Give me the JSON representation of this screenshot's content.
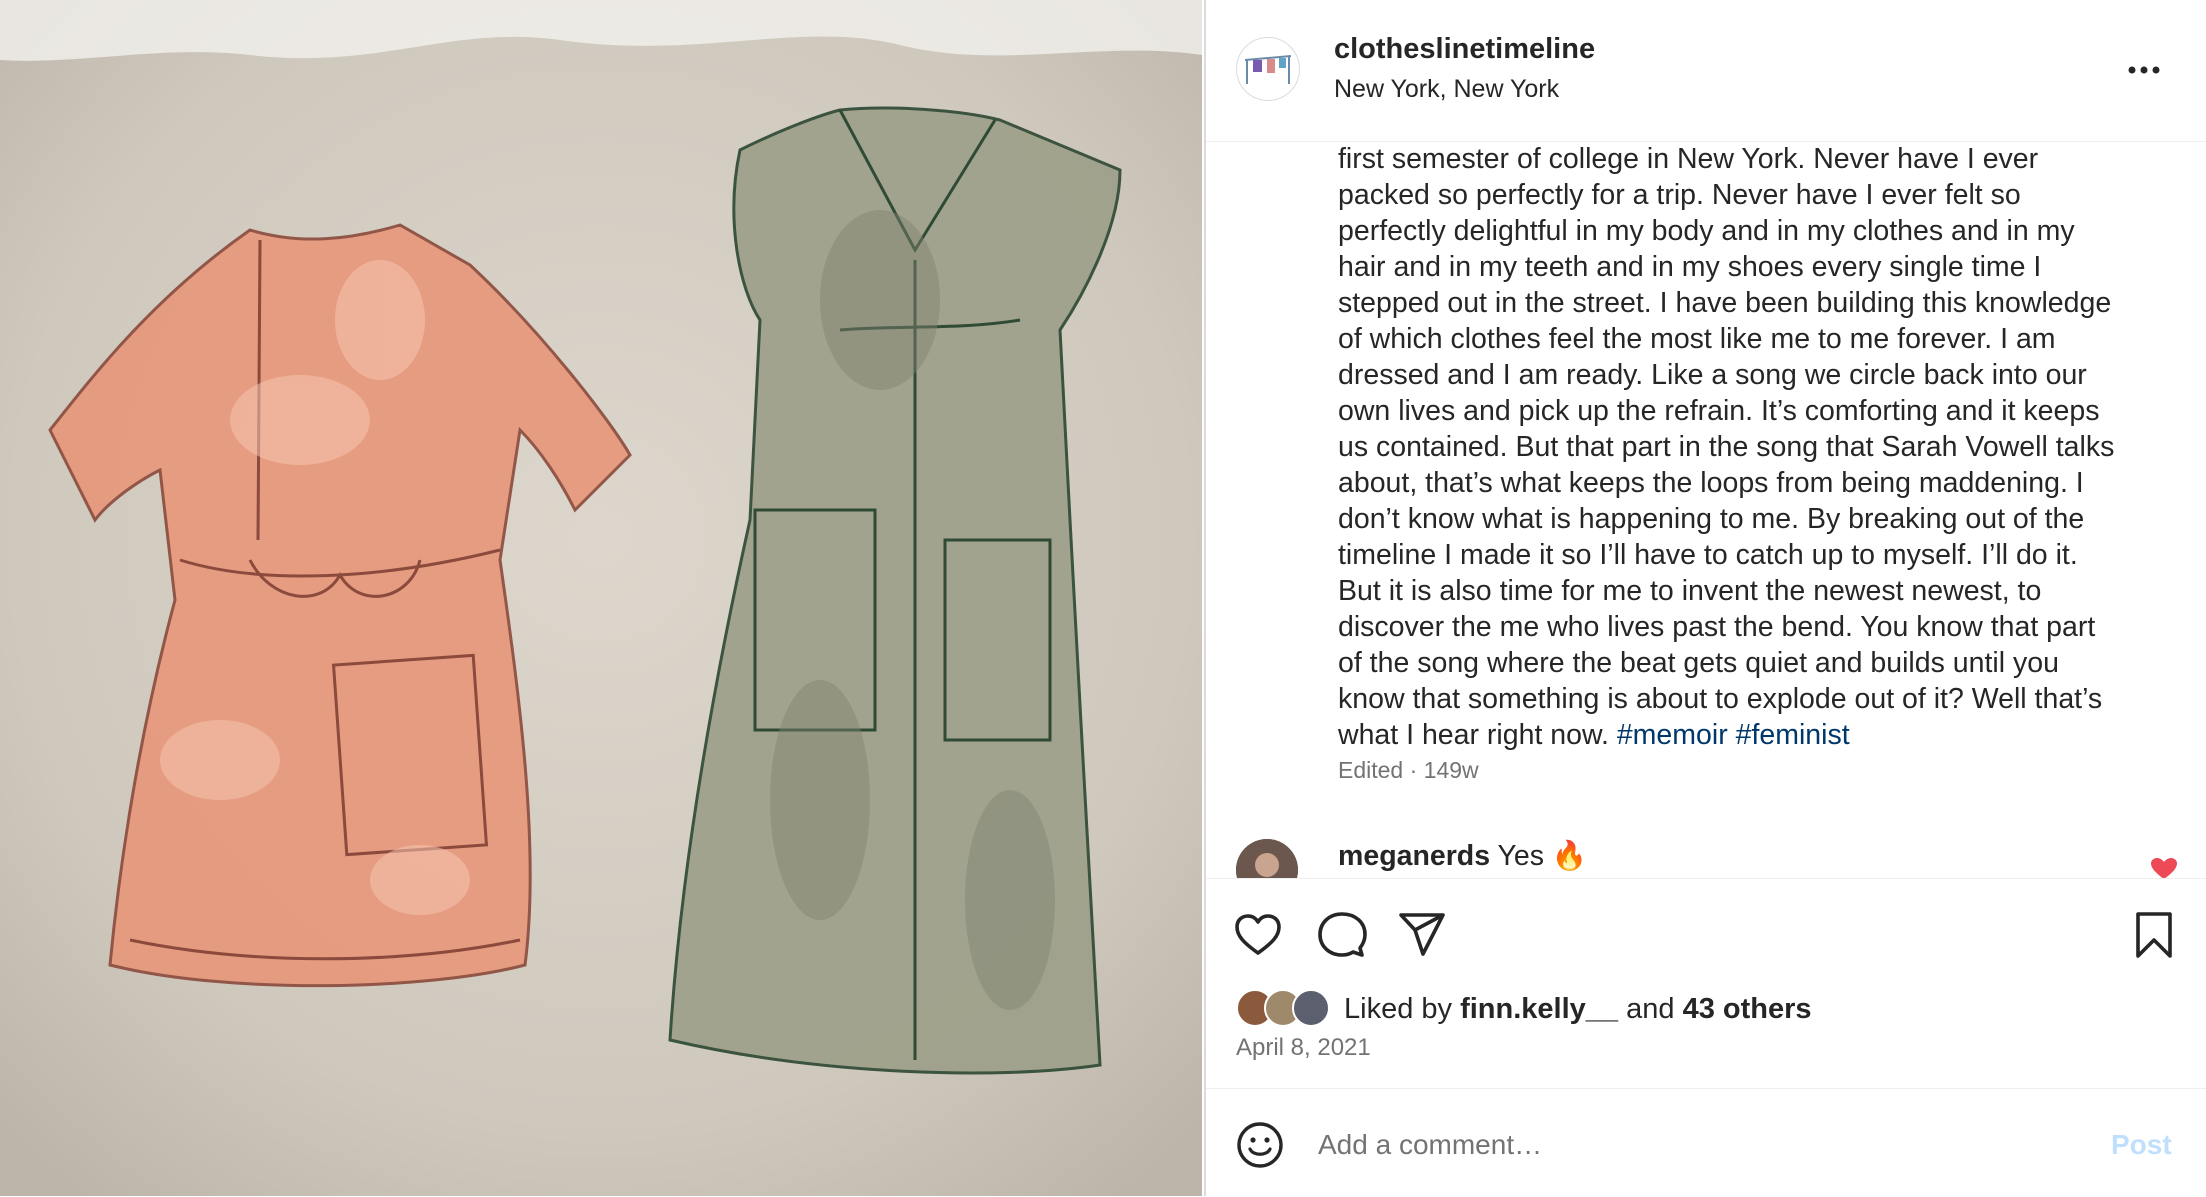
{
  "post": {
    "username": "clotheslinetimeline",
    "location": "New York, New York",
    "caption_lines": [
      "first semester of college in New York. Never have I ever",
      "packed so perfectly for a trip. Never have I ever felt so",
      "perfectly delightful in my body and in my clothes and in my",
      "hair and in my teeth and in my shoes every single time I",
      "stepped out in the street. I have been building this knowledge",
      "of which clothes feel the most like me to me forever. I am",
      "dressed and I am ready. Like a song we circle back into our",
      "own lives and pick up the refrain. It’s comforting and it keeps",
      "us contained. But that part in the song that Sarah Vowell talks",
      "about, that’s what keeps the loops from being maddening. I",
      "don’t know what is happening to me. By breaking out of the",
      "timeline I made it so I’ll have to catch up to myself. I’ll do it.",
      "But it is also time for me to invent the newest newest, to",
      "discover the me who lives past the bend. You know that part",
      "of the song where the beat gets quiet and builds until you",
      "know that something is about to explode out of it? Well that’s"
    ],
    "caption_last_line": "what I hear right now.",
    "hashtags": [
      "#memoir",
      "#feminist"
    ],
    "meta": "Edited · 149w",
    "comment": {
      "username": "meganerds",
      "text": "Yes 🔥"
    },
    "likes": {
      "prefix": "Liked by",
      "first_user": "finn.kelly__",
      "middle": "and",
      "others": "43 others"
    },
    "date": "April 8, 2021"
  },
  "comment_box": {
    "placeholder": "Add a comment…",
    "post_label": "Post"
  },
  "colors": {
    "accent_link": "#00376b",
    "post_disabled": "#c0dffd",
    "heart_red": "#ed4956"
  },
  "icons": [
    "more-icon",
    "like-icon",
    "comment-icon",
    "share-icon",
    "save-icon",
    "emoji-icon",
    "heart-icon"
  ]
}
